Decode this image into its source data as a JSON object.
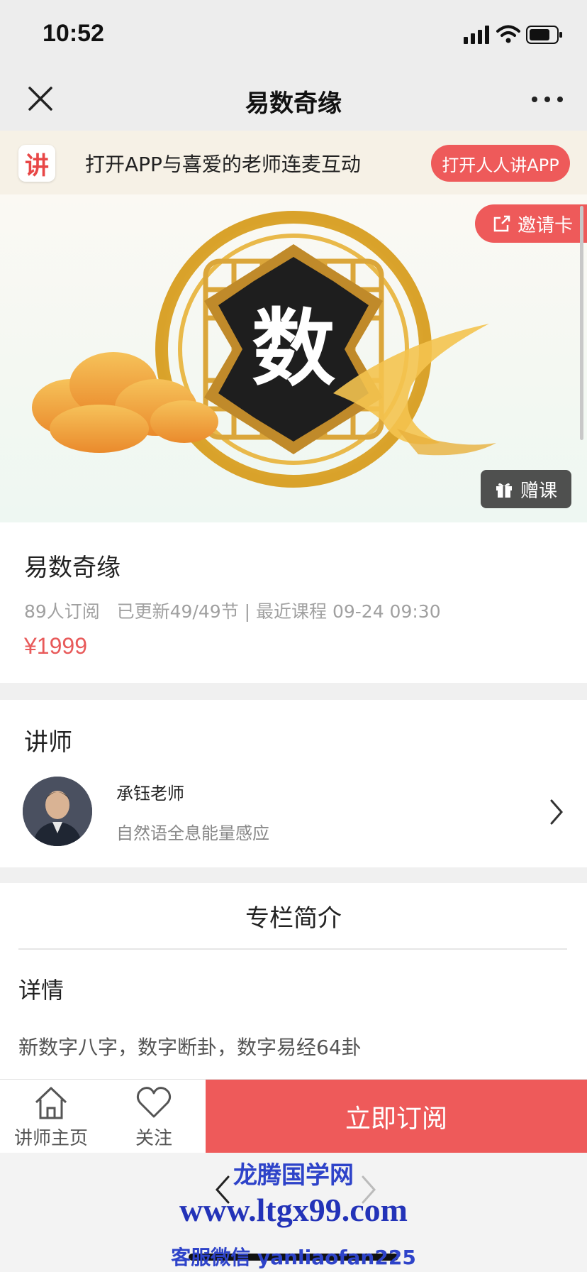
{
  "status_bar": {
    "time": "10:52"
  },
  "nav": {
    "title": "易数奇缘"
  },
  "app_banner": {
    "logo_char": "讲",
    "text": "打开APP与喜爱的老师连麦互动",
    "button_label": "打开人人讲APP"
  },
  "hero": {
    "glyph": "数",
    "invite_label": "邀请卡",
    "gift_label": "赠课"
  },
  "course": {
    "title": "易数奇缘",
    "meta": "89人订阅   已更新49/49节 | 最近课程 09-24 09:30",
    "price": "¥1999"
  },
  "lecturer": {
    "heading": "讲师",
    "name": "承钰老师",
    "description": "自然语全息能量感应"
  },
  "intro": {
    "heading": "专栏简介",
    "detail_heading": "详情",
    "detail_text": "新数字八字，数字断卦，数字易经64卦"
  },
  "bottom_bar": {
    "home_label": "讲师主页",
    "follow_label": "关注",
    "subscribe_label": "立即订阅"
  },
  "watermark": {
    "name": "龙腾国学网",
    "url": "www.ltgx99.com",
    "contact": "客服微信 yanliaofan225"
  },
  "colors": {
    "accent": "#ee5a5a",
    "price": "#e85a5a",
    "watermark": "#2e43c9"
  }
}
